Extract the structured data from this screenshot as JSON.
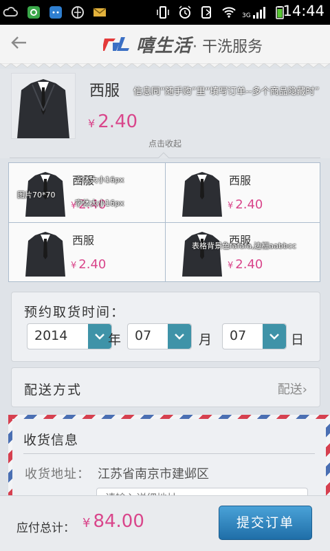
{
  "status_bar": {
    "time": "14:44",
    "network": "3G"
  },
  "header": {
    "brand_name": "嘻生活",
    "brand_sub": "· 干洗服务"
  },
  "product": {
    "name": "西服",
    "currency": "¥",
    "price": "2.40",
    "note": "信息同“随手购”里“填写订单--多个商品隐藏时”",
    "collapse_label": "点击收起"
  },
  "items": [
    {
      "name": "西服",
      "currency": "¥",
      "price": "2.40"
    },
    {
      "name": "西服",
      "currency": "¥",
      "price": "2.40"
    },
    {
      "name": "西服",
      "currency": "¥",
      "price": "2.40"
    },
    {
      "name": "西服",
      "currency": "¥",
      "price": "2.40"
    }
  ],
  "annotations": {
    "image_size": "图片70*70",
    "font_size_1": "字体大小16px",
    "font_size_2": "字体大小16px",
    "table_style": "表格背景色fafafa,边框aabbcc"
  },
  "pickup": {
    "label": "预约取货时间：",
    "year": "2014",
    "year_unit": "年",
    "month": "07",
    "month_unit": "月",
    "day": "07",
    "day_unit": "日"
  },
  "delivery": {
    "label": "配送方式",
    "value": "配送",
    "chevron": "›"
  },
  "shipping": {
    "title": "收货信息",
    "address_label": "收货地址：",
    "address_value": "江苏省南京市建邺区",
    "detail_placeholder": "请输入详细地址"
  },
  "bottom": {
    "total_label": "应付总计：",
    "currency": "¥",
    "total": "84.00",
    "submit_label": "提交订单"
  },
  "colors": {
    "price": "#d9468b",
    "dropdown_arrow": "#3f93a8",
    "submit": "#2a82c2",
    "table_bg": "#fafafa",
    "table_border": "#abbbcc"
  }
}
